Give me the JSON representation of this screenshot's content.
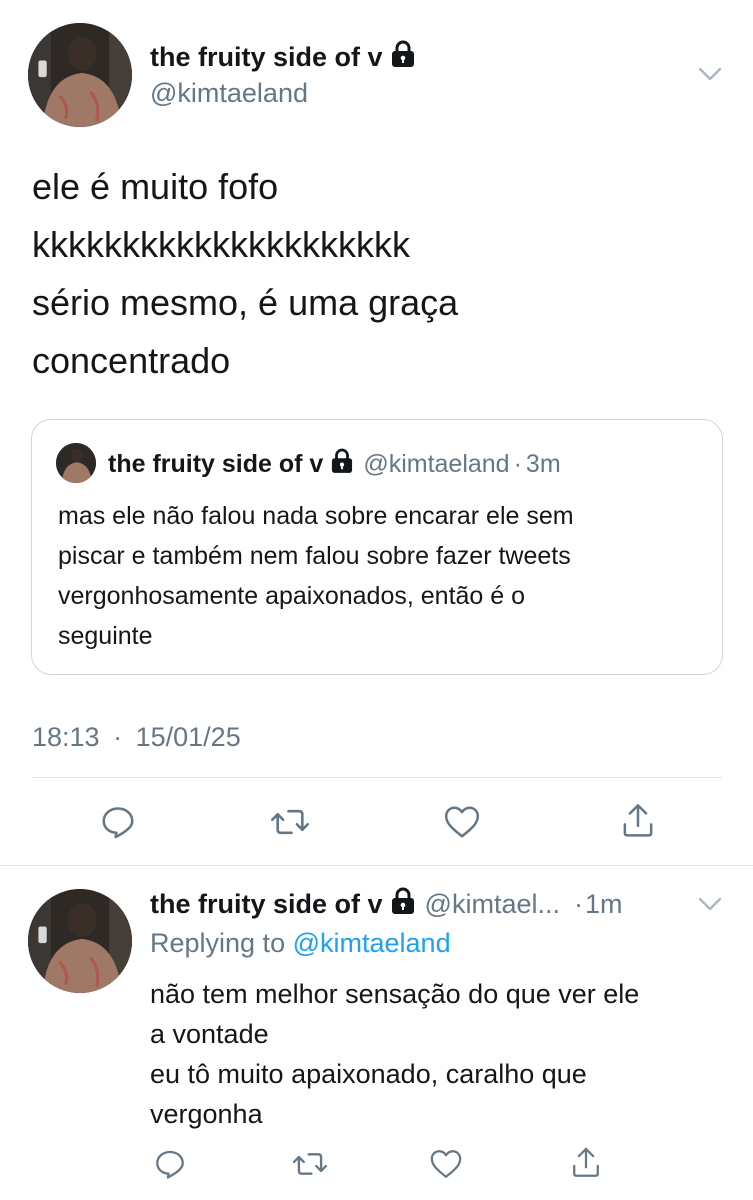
{
  "tweet": {
    "author_name": "the fruity side of v",
    "author_handle": "@kimtaeland",
    "lines": [
      "ele é muito fofo",
      "kkkkkkkkkkkkkkkkkkkkk",
      "sério mesmo, é uma graça",
      "concentrado"
    ],
    "quote": {
      "author_name": "the fruity side of v",
      "author_handle": "@kimtaeland",
      "separator": "·",
      "time": "3m",
      "lines": [
        "mas ele não falou nada sobre encarar ele sem",
        "piscar e também nem falou sobre fazer tweets",
        "vergonhosamente apaixonados, então é o",
        "seguinte"
      ]
    },
    "time": "18:13",
    "separator": "·",
    "date": "15/01/25"
  },
  "reply": {
    "author_name": "the fruity side of v",
    "author_handle": "@kimtael...",
    "separator": "·",
    "time": "1m",
    "replying_prefix": "Replying to",
    "replying_to": "@kimtaeland",
    "lines": [
      "não tem melhor sensação do que ver ele",
      "a vontade",
      "eu tô muito apaixonado, caralho que",
      "vergonha"
    ]
  },
  "icons": {
    "reply": "comment-icon",
    "retweet": "retweet-icon",
    "like": "heart-icon",
    "share": "share-icon",
    "lock": "lock-icon",
    "more": "chevron-down-icon"
  },
  "colors": {
    "text": "#14171a",
    "muted": "#657786",
    "link": "#1da1f2",
    "border": "#ccd6dd",
    "divider": "#e1e8ed"
  }
}
